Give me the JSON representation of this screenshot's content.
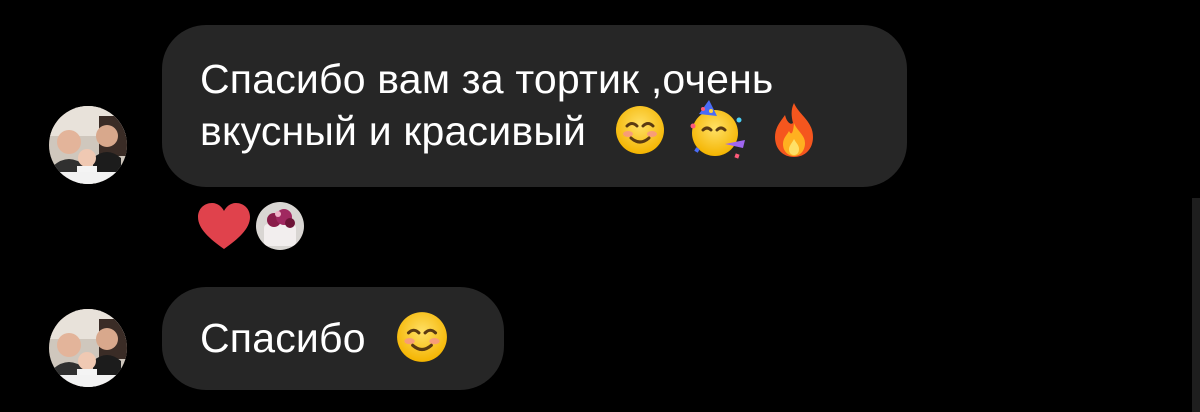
{
  "messages": [
    {
      "lines": [
        "Спасибо вам за тортик ,очень",
        "вкусный и красивый"
      ],
      "emojis": [
        "smiling-face-icon",
        "partying-face-icon",
        "fire-icon"
      ]
    },
    {
      "lines": [
        "Спасибо"
      ],
      "emojis": [
        "smiling-face-icon"
      ]
    }
  ],
  "reactions": [
    "heart-icon",
    "reactor-avatar"
  ],
  "colors": {
    "background": "#000000",
    "bubble": "#262626",
    "text": "#ffffff",
    "heart": "#e0424c"
  }
}
